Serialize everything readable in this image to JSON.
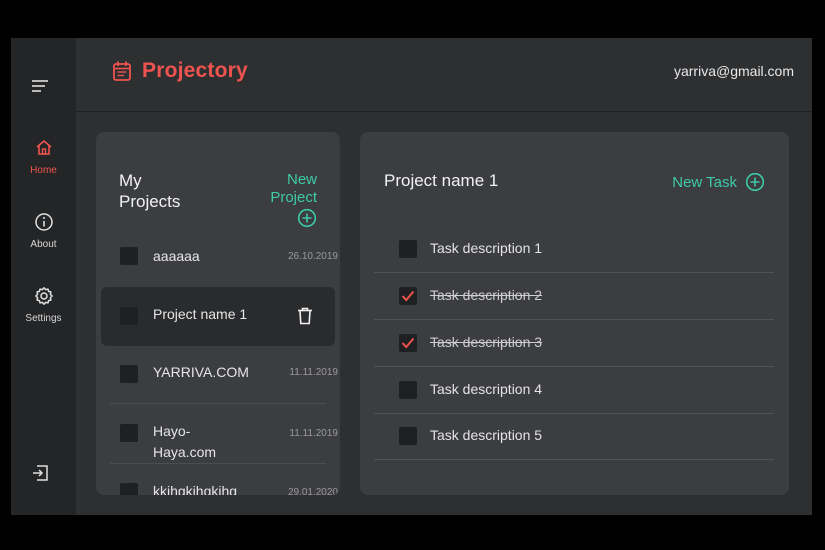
{
  "app": {
    "title": "Projectory",
    "user_email": "yarriva@gmail.com"
  },
  "sidebar": {
    "items": [
      {
        "label": "Home",
        "icon": "home-icon",
        "active": true
      },
      {
        "label": "About",
        "icon": "info-icon",
        "active": false
      },
      {
        "label": "Settings",
        "icon": "gear-icon",
        "active": false
      }
    ]
  },
  "projects": {
    "title": "My Projects",
    "new_label": "New Project",
    "items": [
      {
        "name": "aaaaaa",
        "date": "26.10.2019"
      },
      {
        "name": "Project name 1",
        "date": ""
      },
      {
        "name": "YARRIVA.COM",
        "date": "11.11.2019"
      },
      {
        "name": "Hayo-Haya.com",
        "date": "11.11.2019"
      },
      {
        "name": "kkihgkihgkihg",
        "date": "29.01.2020"
      }
    ]
  },
  "tasks": {
    "title": "Project name 1",
    "new_label": "New Task",
    "items": [
      {
        "desc": "Task description 1",
        "done": false
      },
      {
        "desc": "Task description 2",
        "done": true
      },
      {
        "desc": "Task description 3",
        "done": true
      },
      {
        "desc": "Task description 4",
        "done": false
      },
      {
        "desc": "Task description 5",
        "done": false
      }
    ]
  },
  "colors": {
    "accent": "#ef5350",
    "teal": "#3dcaa9",
    "background": "#2e2f31",
    "sidebar": "#242527",
    "card": "#3c3d40"
  }
}
